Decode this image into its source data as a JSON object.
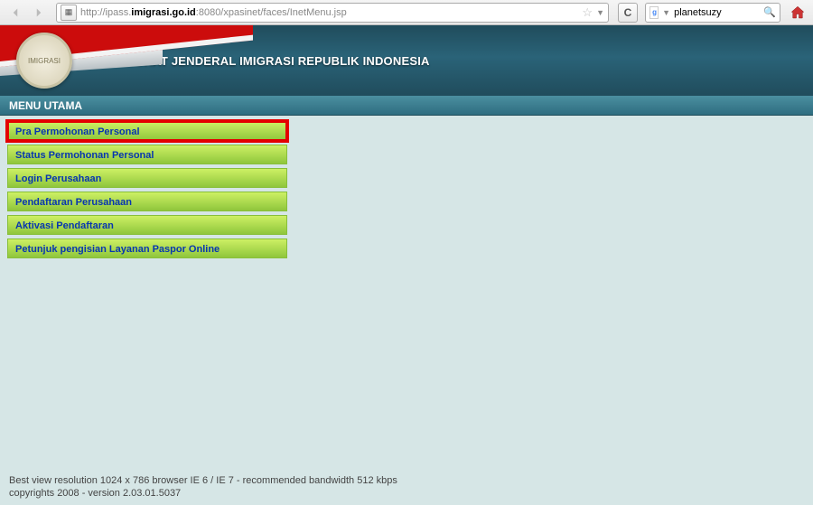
{
  "browser": {
    "url_proto": "http://ipass.",
    "url_domain": "imigrasi.go.id",
    "url_path": ":8080/xpasinet/faces/InetMenu.jsp",
    "search_value": "planetsuzy"
  },
  "banner": {
    "seal_text": "IMIGRASI",
    "title": "DIREKTORAT JENDERAL IMIGRASI REPUBLIK INDONESIA"
  },
  "menubar": {
    "title": "MENU UTAMA"
  },
  "menu": {
    "items": [
      {
        "label": "Pra Permohonan Personal",
        "highlighted": true
      },
      {
        "label": "Status Permohonan Personal",
        "highlighted": false
      },
      {
        "label": "Login Perusahaan",
        "highlighted": false
      },
      {
        "label": "Pendaftaran Perusahaan",
        "highlighted": false
      },
      {
        "label": "Aktivasi Pendaftaran",
        "highlighted": false
      },
      {
        "label": "Petunjuk pengisian Layanan Paspor Online",
        "highlighted": false
      }
    ]
  },
  "footer": {
    "line1": "Best view resolution 1024 x 786 browser IE 6 / IE 7 - recommended bandwidth 512 kbps",
    "line2": "copyrights 2008 - version 2.03.01.5037"
  }
}
